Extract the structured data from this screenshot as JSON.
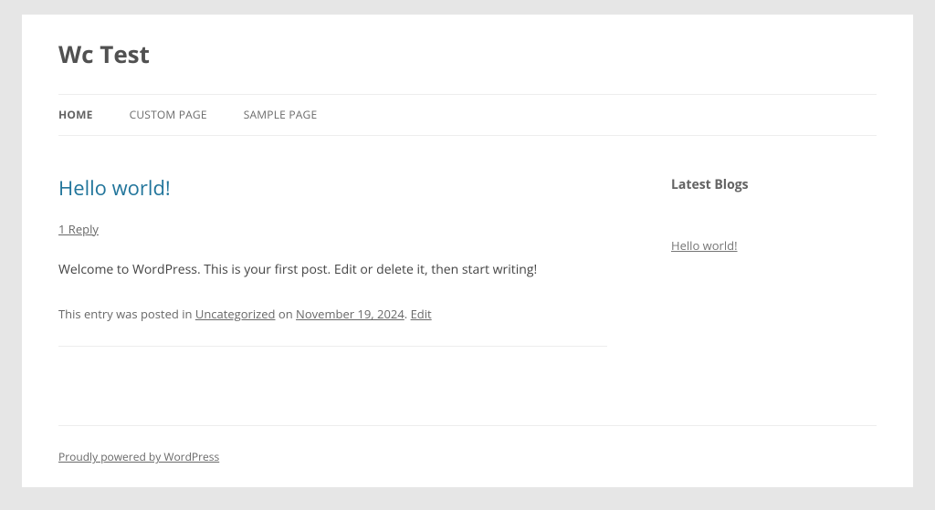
{
  "header": {
    "title": "Wc Test"
  },
  "nav": {
    "items": [
      {
        "label": "Home",
        "current": true
      },
      {
        "label": "Custom Page",
        "current": false
      },
      {
        "label": "Sample Page",
        "current": false
      }
    ]
  },
  "post": {
    "title": "Hello world!",
    "comments_text": "1 Reply",
    "body": "Welcome to WordPress. This is your first post. Edit or delete it, then start writing!",
    "meta_prefix": "This entry was posted in ",
    "category": "Uncategorized",
    "meta_on": " on ",
    "date": "November 19, 2024",
    "meta_period": ". ",
    "edit_label": "Edit"
  },
  "sidebar": {
    "widget_title": "Latest Blogs",
    "items": [
      {
        "label": "Hello world!"
      }
    ]
  },
  "footer": {
    "credit": "Proudly powered by WordPress"
  }
}
